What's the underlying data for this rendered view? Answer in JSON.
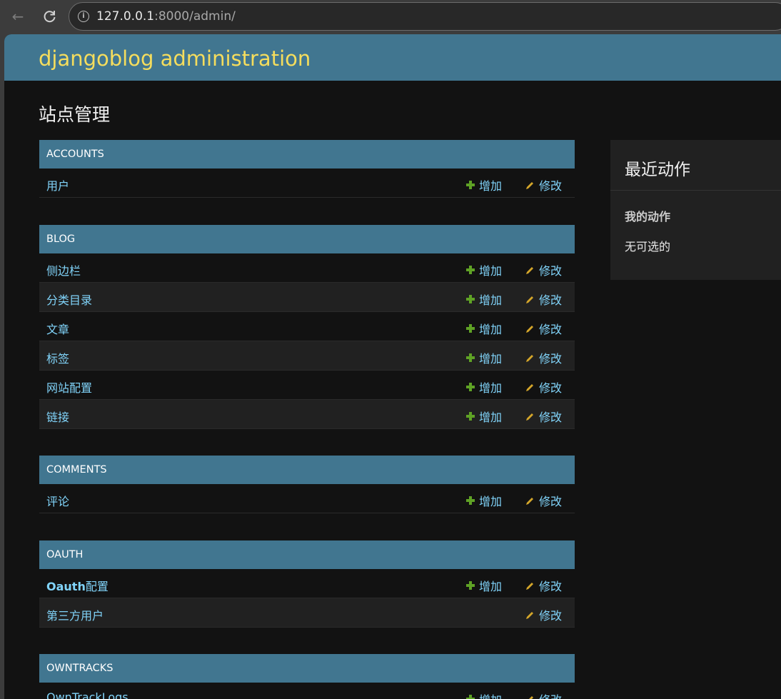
{
  "browser": {
    "url_host": "127.0.0.1",
    "url_rest": ":8000/admin/"
  },
  "header": {
    "site_name": "djangoblog administration"
  },
  "page_title": "站点管理",
  "modules": [
    {
      "caption": "ACCOUNTS",
      "models": [
        {
          "name": "用户",
          "add": "增加",
          "change": "修改"
        }
      ]
    },
    {
      "caption": "BLOG",
      "models": [
        {
          "name": "侧边栏",
          "add": "增加",
          "change": "修改"
        },
        {
          "name": "分类目录",
          "add": "增加",
          "change": "修改"
        },
        {
          "name": "文章",
          "add": "增加",
          "change": "修改"
        },
        {
          "name": "标签",
          "add": "增加",
          "change": "修改"
        },
        {
          "name": "网站配置",
          "add": "增加",
          "change": "修改"
        },
        {
          "name": "链接",
          "add": "增加",
          "change": "修改"
        }
      ]
    },
    {
      "caption": "COMMENTS",
      "models": [
        {
          "name": "评论",
          "add": "增加",
          "change": "修改"
        }
      ]
    },
    {
      "caption": "OAUTH",
      "models": [
        {
          "name_bold": "Oauth",
          "name": "配置",
          "add": "增加",
          "change": "修改"
        },
        {
          "name": "第三方用户",
          "change": "修改"
        }
      ]
    },
    {
      "caption": "OWNTRACKS",
      "models": [
        {
          "name": "OwnTrackLogs",
          "add": "增加",
          "change": "修改"
        }
      ]
    }
  ],
  "recent_actions": {
    "title": "最近动作",
    "my_actions": "我的动作",
    "none_available": "无可选的"
  },
  "colors": {
    "header_bg": "#417690",
    "site_name": "#f5dd5d",
    "link": "#81d4fa",
    "add_icon": "#5fa225",
    "change_icon": "#d4a62a"
  }
}
